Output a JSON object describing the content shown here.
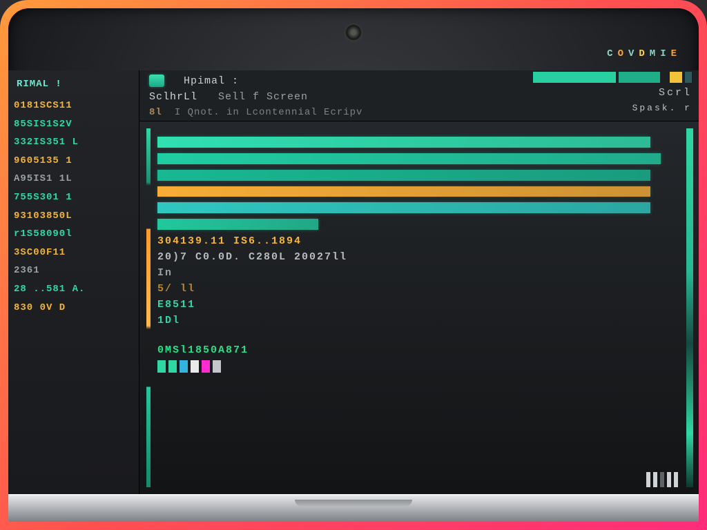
{
  "brand": "COVDMIE",
  "header": {
    "prompt": "Hpimal :",
    "tabs": [
      "SclhrLl",
      "Sell f Screen"
    ],
    "right_label": "Scrl",
    "subnum": "8l",
    "subtext": "I Qnot. in Lcontennial Ecripv",
    "subright": "Spask. r"
  },
  "sidebar": {
    "title": "RIMAL !",
    "lines": [
      {
        "text": "0181SCS11",
        "color": "#f2b33a"
      },
      {
        "text": "85SIS1S2V",
        "color": "#2fd7a3"
      },
      {
        "text": "332IS351 L",
        "color": "#2fd7a3"
      },
      {
        "text": "9605135 1",
        "color": "#f2b33a"
      },
      {
        "text": "A95IS1 1L",
        "color": "#9aa1a6"
      },
      {
        "text": "755S301 1",
        "color": "#2fd7a3"
      },
      {
        "text": "93103850L",
        "color": "#f2b33a"
      },
      {
        "text": "r1S58090l",
        "color": "#2fd7a3"
      },
      {
        "text": "3SC00F11",
        "color": "#f2b33a"
      },
      {
        "text": "2361",
        "color": "#9aa1a6"
      },
      {
        "text": "28 ..581 A.",
        "color": "#2fd7a3"
      },
      {
        "text": "830 0V D",
        "color": "#f2b33a"
      }
    ]
  },
  "chart_data": {
    "type": "bar",
    "orientation": "horizontal",
    "series": [
      {
        "name": "bar1",
        "value": 92,
        "color": "#2fe0b0"
      },
      {
        "name": "bar2",
        "value": 94,
        "color": "#20cda3"
      },
      {
        "name": "bar3",
        "value": 92,
        "color": "#18b893"
      },
      {
        "name": "bar4",
        "value": 92,
        "color": "#f7ad36"
      },
      {
        "name": "bar5",
        "value": 92,
        "color": "#2fc7c0"
      },
      {
        "name": "bar6",
        "value": 30,
        "color": "#22c89d"
      }
    ],
    "xlim": [
      0,
      100
    ]
  },
  "terminal": {
    "l1": "304139.11 IS6..1894",
    "l2": "20)7 C0.0D. C280L 20027ll",
    "l3": "In",
    "l4": "5/ ll",
    "l5": "E8511",
    "l6": "1Dl",
    "l7": "0MSl1850A871",
    "mini_colors": [
      "#2fd7a3",
      "#2fd7a3",
      "#33b4e0",
      "#eaeaea",
      "#ff2cd0",
      "#c4c6cc"
    ]
  },
  "progress_label": "",
  "colors": {
    "accent_green": "#2fd7a3",
    "accent_orange": "#f7ad36",
    "accent_blue": "#2fc7c0"
  }
}
